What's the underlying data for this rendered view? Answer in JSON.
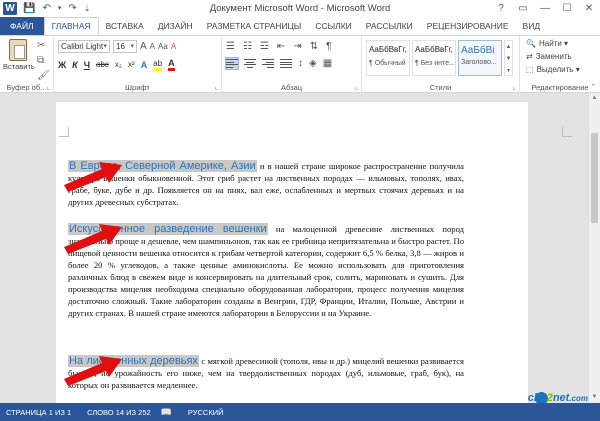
{
  "window": {
    "title": "Документ Microsoft Word - Microsoft Word",
    "app_letter": "W",
    "controls": {
      "help": "?",
      "ribbon_display": "▭",
      "minimize": "—",
      "maximize": "☐",
      "close": "✕"
    }
  },
  "quick_access": {
    "save": "💾",
    "undo": "↶",
    "undo_drop": "▾",
    "redo": "↷",
    "customize": "⇣"
  },
  "tabs": [
    {
      "label": "ФАЙЛ"
    },
    {
      "label": "ГЛАВНАЯ"
    },
    {
      "label": "ВСТАВКА"
    },
    {
      "label": "ДИЗАЙН"
    },
    {
      "label": "РАЗМЕТКА СТРАНИЦЫ"
    },
    {
      "label": "ССЫЛКИ"
    },
    {
      "label": "РАССЫЛКИ"
    },
    {
      "label": "РЕЦЕНЗИРОВАНИЕ"
    },
    {
      "label": "ВИД"
    }
  ],
  "ribbon": {
    "clipboard": {
      "paste_label": "Вставить",
      "group_label": "Буфер об...",
      "launcher": "⌞"
    },
    "font": {
      "font_name": "Calibri Light",
      "font_size": "16",
      "grow": "A",
      "shrink": "A",
      "case": "Aa",
      "clear": "A",
      "bold": "Ж",
      "italic": "К",
      "underline": "Ч",
      "strike": "abc",
      "subscript": "x₂",
      "superscript": "x²",
      "effects": "A",
      "highlight": "ab",
      "color": "A",
      "group_label": "Шрифт",
      "launcher": "⌞"
    },
    "paragraph": {
      "group_label": "Абзац",
      "pilcrow": "¶",
      "launcher": "⌞"
    },
    "styles": {
      "items": [
        {
          "sample": "АаБбВвГг,",
          "name": "¶ Обычный"
        },
        {
          "sample": "АаБбВвГг,",
          "name": "¶ Без инте..."
        },
        {
          "sample": "АаБбВі",
          "name": "Заголово..."
        }
      ],
      "group_label": "Стили",
      "launcher": "⌞"
    },
    "editing": {
      "find": "Найти",
      "replace": "Заменить",
      "select": "Выделить",
      "group_label": "Редактирование"
    }
  },
  "document": {
    "paragraphs": [
      {
        "heading": "В Европе, Северной Америке, Азии",
        "text": " и в нашей стране широкое распространение получила культура вешенки обыкновенной. Этот гриб растет на лиственных породах — ильмовых, тополях, ивах, грабе, буке, дубе и др. Появляется он на пнях, вал еже, ослабленных и мертвых стоячих деревьях и на других древесных субстратах."
      },
      {
        "heading": "Искусственное разведение вешенки",
        "text": " на малоценной древесине лиственных пород значительно проще и дешевле, чем шампиньонов, так как ее грибница непритязательна и быстро растет. По пищевой ценности вешенка относится к грибам четвертой категории, содержит 6,5 % белка, 3,8 — жиров и более 20 % углеводов, а также ценные аминокислоты. Ее можно использовать для приготовления различных блюд в свежем виде и консервировать на длительный срок, солить, мариновать и сушить. Для производства мицелия необходима специально оборудованная лаборатория, процесс получения мицелия достаточно сложный. Такие лаборатории созданы в Венгрии, ГДР, Франции, Италии, Польше, Австрии и других странах. В нашей стране имеются лаборатории в Белоруссии и на Украине."
      },
      {
        "heading": "На лиственных деревьях",
        "text": " с мягкой древесиной (тополя, ивы и др.) мицелий вешенки развивается быстро, но урожайность его ниже, чем на твердолиственных породах (дуб, ильмовые, граб, бук), на которых он развивается медленнее."
      }
    ]
  },
  "statusbar": {
    "page": "СТРАНИЦА 1 ИЗ 1",
    "words": "СЛОВО 14 ИЗ 252",
    "language": "РУССКИЙ"
  },
  "watermark": {
    "part1": "clip",
    "part2": "2",
    "part3": "net",
    "part4": ".com"
  },
  "colors": {
    "accent": "#2b579a",
    "heading": "#2e74b5",
    "arrow": "#e01010",
    "highlight": "#c8c8c8"
  }
}
